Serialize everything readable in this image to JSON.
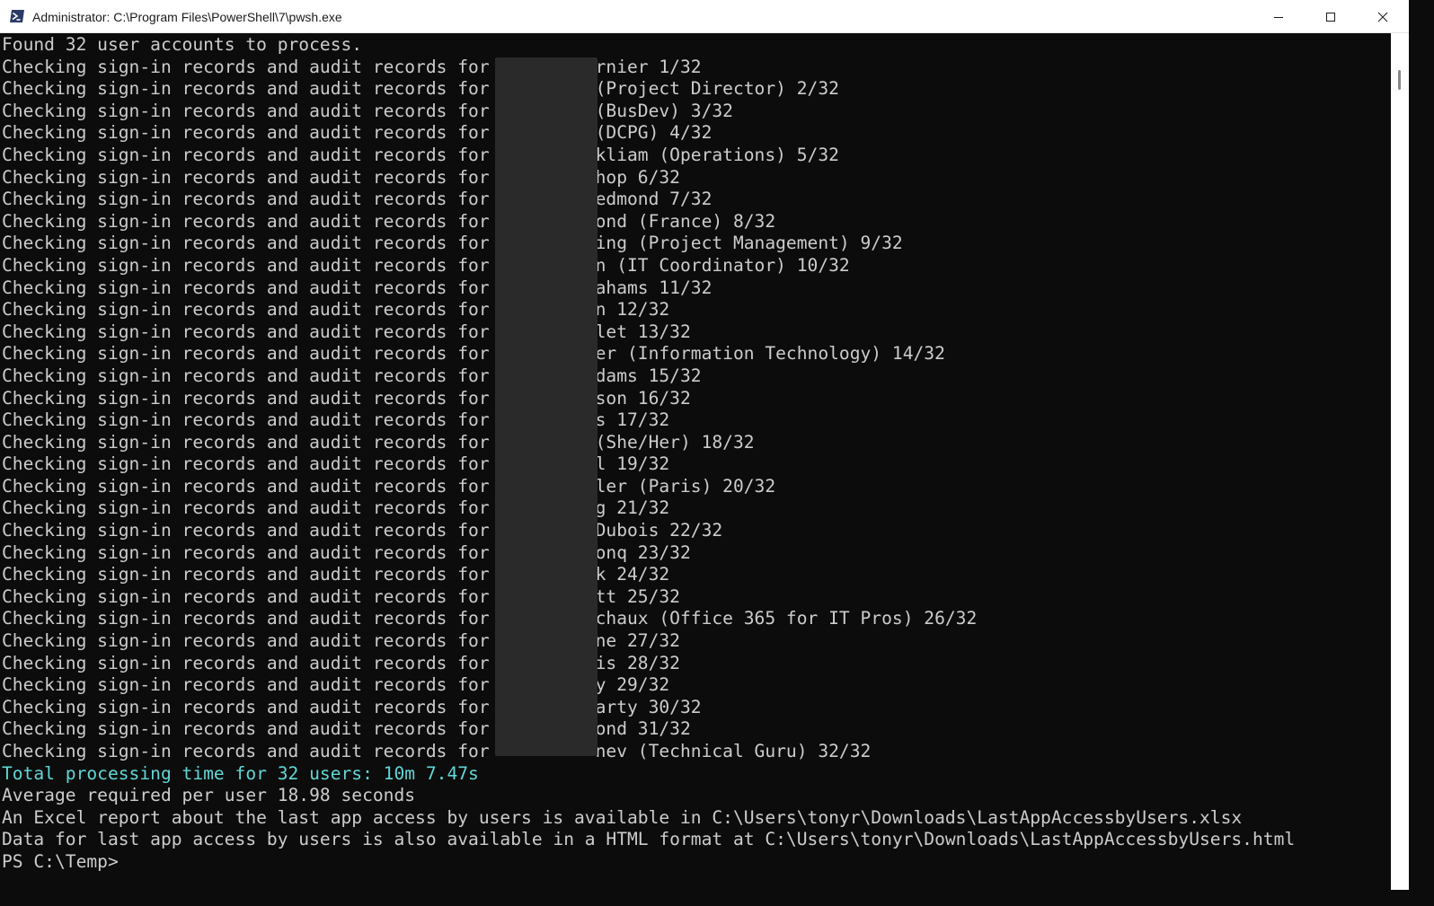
{
  "window": {
    "title": "Administrator: C:\\Program Files\\PowerShell\\7\\pwsh.exe",
    "icon": "powershell-icon"
  },
  "controls": {
    "minimize_icon": "minimize-icon",
    "maximize_icon": "maximize-icon",
    "close_icon": "close-icon"
  },
  "colors": {
    "background": "#0c0c0c",
    "foreground": "#cccccc",
    "highlight": "#61d6d6"
  },
  "terminal": {
    "lines": [
      {
        "text": "Found 32 user accounts to process."
      },
      {
        "text": "Checking sign-in records and audit records for          rnier 1/32"
      },
      {
        "text": "Checking sign-in records and audit records for          (Project Director) 2/32"
      },
      {
        "text": "Checking sign-in records and audit records for          (BusDev) 3/32"
      },
      {
        "text": "Checking sign-in records and audit records for          (DCPG) 4/32"
      },
      {
        "text": "Checking sign-in records and audit records for          kliam (Operations) 5/32"
      },
      {
        "text": "Checking sign-in records and audit records for          hop 6/32"
      },
      {
        "text": "Checking sign-in records and audit records for          edmond 7/32"
      },
      {
        "text": "Checking sign-in records and audit records for          ond (France) 8/32"
      },
      {
        "text": "Checking sign-in records and audit records for          ing (Project Management) 9/32"
      },
      {
        "text": "Checking sign-in records and audit records for          n (IT Coordinator) 10/32"
      },
      {
        "text": "Checking sign-in records and audit records for          ahams 11/32"
      },
      {
        "text": "Checking sign-in records and audit records for          n 12/32"
      },
      {
        "text": "Checking sign-in records and audit records for          let 13/32"
      },
      {
        "text": "Checking sign-in records and audit records for          er (Information Technology) 14/32"
      },
      {
        "text": "Checking sign-in records and audit records for          dams 15/32"
      },
      {
        "text": "Checking sign-in records and audit records for          son 16/32"
      },
      {
        "text": "Checking sign-in records and audit records for          s 17/32"
      },
      {
        "text": "Checking sign-in records and audit records for          (She/Her) 18/32"
      },
      {
        "text": "Checking sign-in records and audit records for          l 19/32"
      },
      {
        "text": "Checking sign-in records and audit records for          ler (Paris) 20/32"
      },
      {
        "text": "Checking sign-in records and audit records for          g 21/32"
      },
      {
        "text": "Checking sign-in records and audit records for          Dubois 22/32"
      },
      {
        "text": "Checking sign-in records and audit records for          onq 23/32"
      },
      {
        "text": "Checking sign-in records and audit records for          k 24/32"
      },
      {
        "text": "Checking sign-in records and audit records for          tt 25/32"
      },
      {
        "text": "Checking sign-in records and audit records for          chaux (Office 365 for IT Pros) 26/32"
      },
      {
        "text": "Checking sign-in records and audit records for          ne 27/32"
      },
      {
        "text": "Checking sign-in records and audit records for          is 28/32"
      },
      {
        "text": "Checking sign-in records and audit records for          y 29/32"
      },
      {
        "text": "Checking sign-in records and audit records for          arty 30/32"
      },
      {
        "text": "Checking sign-in records and audit records for          ond 31/32"
      },
      {
        "text": "Checking sign-in records and audit records for          nev (Technical Guru) 32/32"
      },
      {
        "text": "Total processing time for 32 users: 10m 7.47s",
        "color": "cyan"
      },
      {
        "text": "Average required per user 18.98 seconds"
      },
      {
        "text": "An Excel report about the last app access by users is available in C:\\Users\\tonyr\\Downloads\\LastAppAccessbyUsers.xlsx"
      },
      {
        "text": "Data for last app access by users is also available in a HTML format at C:\\Users\\tonyr\\Downloads\\LastAppAccessbyUsers.html"
      },
      {
        "text": "PS C:\\Temp>"
      }
    ]
  }
}
